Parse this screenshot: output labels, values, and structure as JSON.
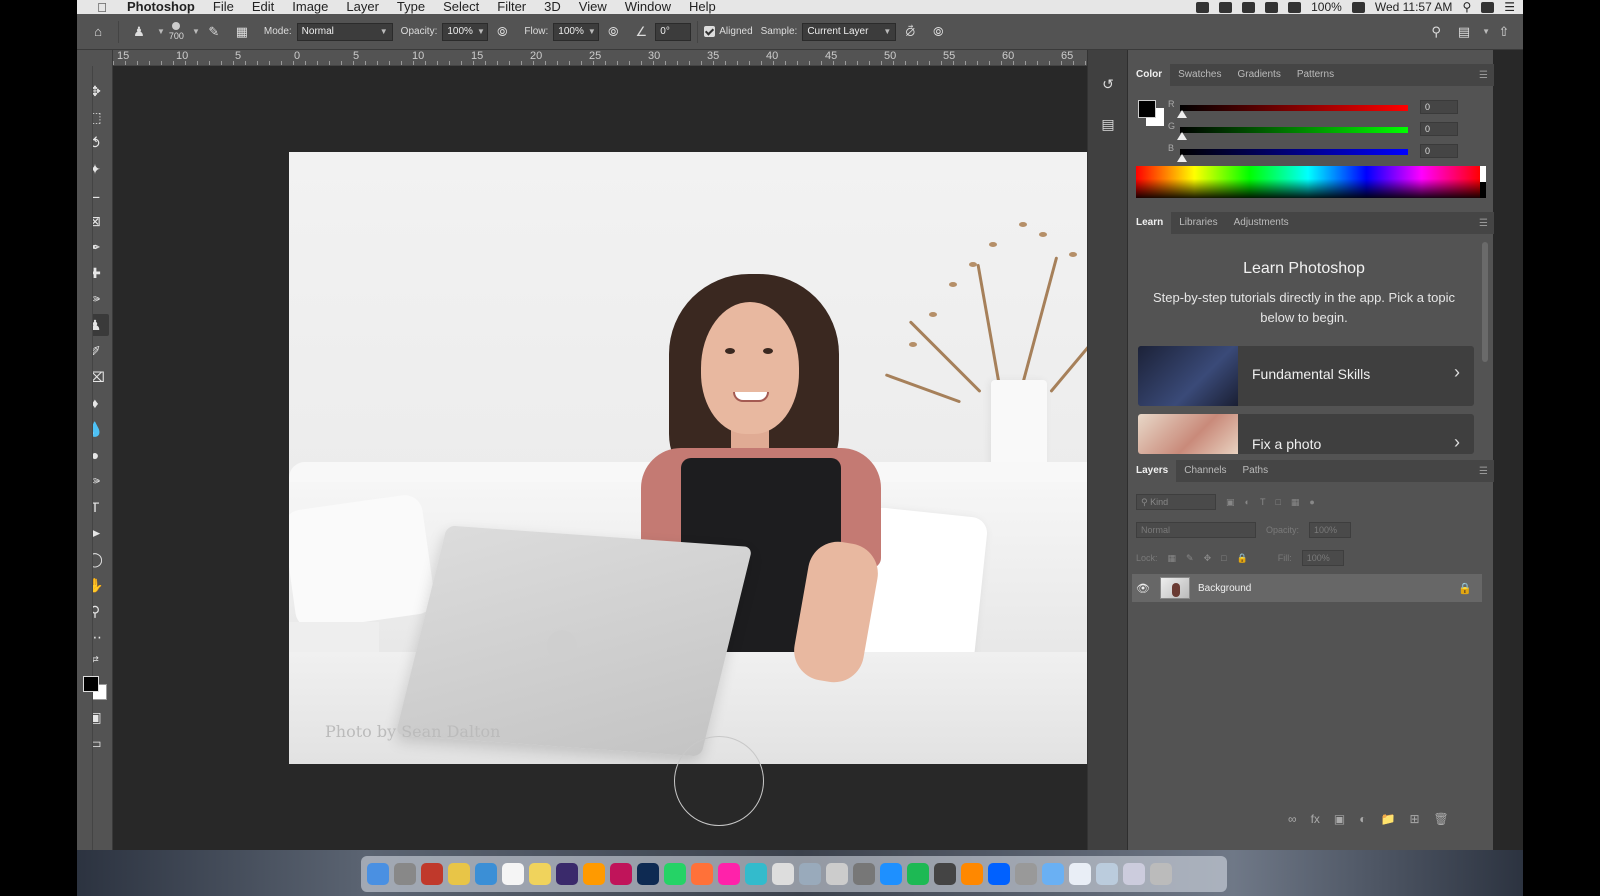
{
  "menubar": {
    "app": "Photoshop",
    "items": [
      "File",
      "Edit",
      "Image",
      "Layer",
      "Type",
      "Select",
      "Filter",
      "3D",
      "View",
      "Window",
      "Help"
    ],
    "battery": "100%",
    "clock": "Wed 11:57 AM"
  },
  "options": {
    "brush_size": "700",
    "mode_label": "Mode:",
    "mode_value": "Normal",
    "opacity_label": "Opacity:",
    "opacity_value": "100%",
    "flow_label": "Flow:",
    "flow_value": "100%",
    "angle_value": "0°",
    "aligned_label": "Aligned",
    "aligned_checked": true,
    "sample_label": "Sample:",
    "sample_value": "Current Layer"
  },
  "ruler": {
    "numbers": [
      "15",
      "10",
      "5",
      "0",
      "5",
      "10",
      "15",
      "20",
      "25",
      "30",
      "35",
      "40",
      "45",
      "50",
      "55",
      "60",
      "65"
    ]
  },
  "canvas": {
    "watermark": "Photo by Sean Dalton"
  },
  "color_panel": {
    "tabs": [
      "Color",
      "Swatches",
      "Gradients",
      "Patterns"
    ],
    "r_label": "R",
    "r_value": "0",
    "g_label": "G",
    "g_value": "0",
    "b_label": "B",
    "b_value": "0",
    "foreground": "#000000",
    "background": "#ffffff"
  },
  "learn_panel": {
    "tabs": [
      "Learn",
      "Libraries",
      "Adjustments"
    ],
    "title": "Learn Photoshop",
    "subtitle": "Step-by-step tutorials directly in the app. Pick a topic below to begin.",
    "cards": [
      "Fundamental Skills",
      "Fix a photo"
    ]
  },
  "layers_panel": {
    "tabs": [
      "Layers",
      "Channels",
      "Paths"
    ],
    "filter_placeholder": "Kind",
    "blend_mode": "Normal",
    "opacity_label": "Opacity:",
    "opacity_value": "100%",
    "lock_label": "Lock:",
    "fill_label": "Fill:",
    "fill_value": "100%",
    "layers": [
      {
        "name": "Background",
        "locked": true,
        "visible": true
      }
    ]
  },
  "colors": {
    "app_bg": "#282828",
    "panel_bg": "#535353",
    "tab_bg": "#454545",
    "layer_selected": "#676767"
  }
}
